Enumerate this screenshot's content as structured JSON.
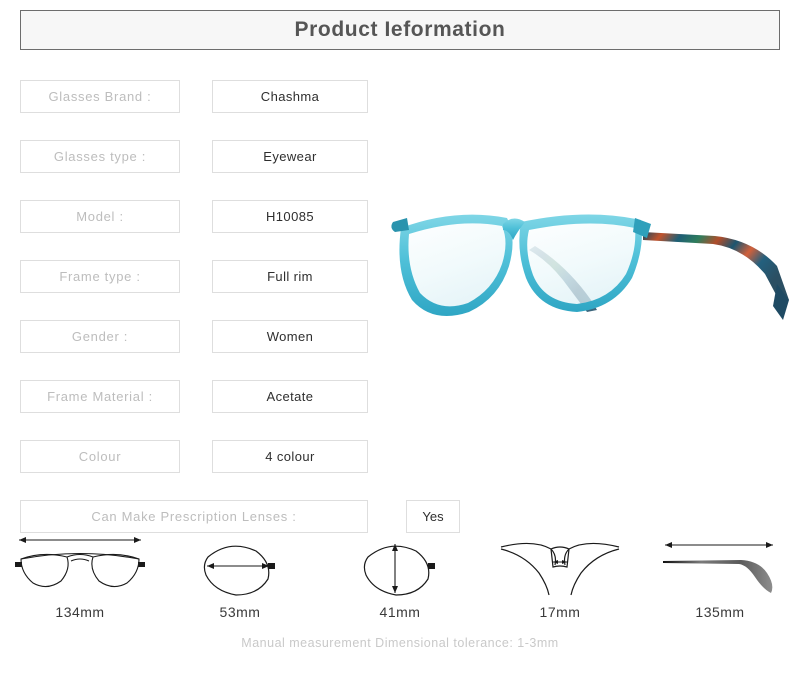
{
  "header": {
    "title": "Product Ieformation"
  },
  "specs": [
    {
      "label": "Glasses Brand :",
      "value": "Chashma"
    },
    {
      "label": "Glasses type :",
      "value": "Eyewear"
    },
    {
      "label": "Model :",
      "value": "H10085"
    },
    {
      "label": "Frame type :",
      "value": "Full rim"
    },
    {
      "label": "Gender :",
      "value": "Women"
    },
    {
      "label": "Frame Material :",
      "value": "Acetate"
    },
    {
      "label": "Colour",
      "value": "4 colour"
    }
  ],
  "prescription": {
    "label": "Can Make Prescription Lenses :",
    "value": "Yes"
  },
  "measurements": [
    {
      "name": "total-width",
      "value": "134mm"
    },
    {
      "name": "lens-width",
      "value": "53mm"
    },
    {
      "name": "lens-height",
      "value": "41mm"
    },
    {
      "name": "bridge-width",
      "value": "17mm"
    },
    {
      "name": "temple-length",
      "value": "135mm"
    }
  ],
  "tolerance_note": "Manual measurement Dimensional tolerance: 1-3mm",
  "product_image": {
    "alt": "Translucent turquoise acetate eyeglasses with multicolor patterned temples",
    "frame_color": "#5bc2d8",
    "frame_color_dark": "#2a93ad",
    "temple_colors": [
      "#1d4f6b",
      "#c4512a",
      "#2d6e52",
      "#7a3b2e",
      "#3a6fa0"
    ]
  }
}
